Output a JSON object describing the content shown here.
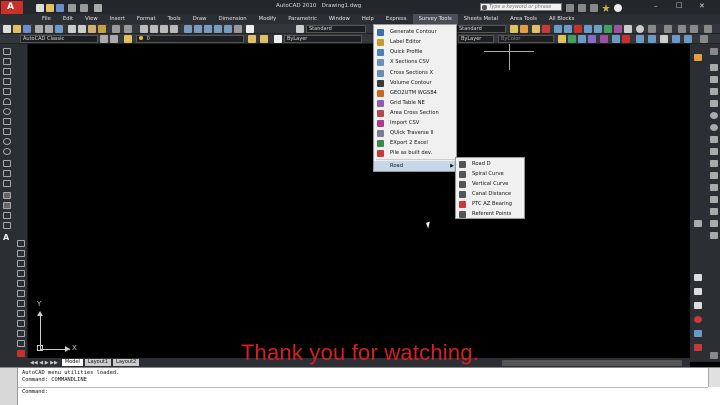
{
  "window": {
    "title": "AutoCAD 2010",
    "document": "Drawing1.dwg",
    "search_placeholder": "Type a keyword or phrase",
    "controls": [
      "–",
      "□",
      "✕"
    ]
  },
  "menubar": [
    "File",
    "Edit",
    "View",
    "Insert",
    "Format",
    "Tools",
    "Draw",
    "Dimension",
    "Modify",
    "Parametric",
    "Window",
    "Help",
    "Express",
    "Survey Tools",
    "Sheets Metal",
    "Area Tools",
    "All Blocks"
  ],
  "toolbars": {
    "text_style": "Standard",
    "dim_style": "Standard",
    "workspace": "AutoCAD Classic",
    "layer": "0",
    "color": "ByLayer",
    "linetype": "ByLayer",
    "plotstyle": "ByColor"
  },
  "survey_menu": [
    {
      "label": "Generate Contour",
      "icon": "contour-icon",
      "color": "#3d6fa8"
    },
    {
      "label": "Label Editor",
      "icon": "label-editor-icon",
      "color": "#c79a2b"
    },
    {
      "label": "Quick Profile",
      "icon": "profile-icon",
      "color": "#4d7fbf"
    },
    {
      "label": "X Sections CSV",
      "icon": "csv-icon",
      "color": "#6b8fb5"
    },
    {
      "label": "Cross Sections X",
      "icon": "cross-section-icon",
      "color": "#6a8eb3"
    },
    {
      "label": "Volume Contour",
      "icon": "volume-icon",
      "color": "#3a3a3a"
    },
    {
      "label": "GEO2UTM WGS84",
      "icon": "geo-icon",
      "color": "#c46a28"
    },
    {
      "label": "Grid Table NE",
      "icon": "grid-icon",
      "color": "#8a5fb0"
    },
    {
      "label": "Area Cross Section",
      "icon": "area-icon",
      "color": "#b04a4a"
    },
    {
      "label": "Import CSV",
      "icon": "import-icon",
      "color": "#b03a8a"
    },
    {
      "label": "QUick Traverse II",
      "icon": "traverse-icon",
      "color": "#7a7a9a"
    },
    {
      "label": "EXport 2 Excel",
      "icon": "excel-icon",
      "color": "#3a8a4a"
    },
    {
      "label": "Pile as built dev.",
      "icon": "pile-icon",
      "color": "#c83a3a"
    },
    {
      "label": "Road",
      "icon": "",
      "color": "",
      "submenu": true
    }
  ],
  "road_submenu": [
    {
      "label": "Road D",
      "icon": "road-icon",
      "color": "#555"
    },
    {
      "label": "Spiral Curve",
      "icon": "spiral-icon",
      "color": "#555"
    },
    {
      "label": "Vertical Curve",
      "icon": "vertical-curve-icon",
      "color": "#555"
    },
    {
      "label": "Canal Distance",
      "icon": "canal-icon",
      "color": "#555"
    },
    {
      "label": "PTC AZ Bearing",
      "icon": "bearing-icon",
      "color": "#c83a3a"
    },
    {
      "label": "Referent Points",
      "icon": "ref-points-icon",
      "color": "#555"
    }
  ],
  "layout_tabs": [
    "Model",
    "Layout1",
    "Layout2"
  ],
  "command": {
    "line1": "AutoCAD menu utilities loaded.",
    "line2": "Command: COMMANDLINE",
    "prompt": "Command:"
  },
  "ucs": {
    "x": "X",
    "y": "Y"
  },
  "subtitle": "Thank you for watching.",
  "colors": {
    "accent": "#c6d7ea",
    "app_red": "#c8302b",
    "caption": "#d42020"
  }
}
